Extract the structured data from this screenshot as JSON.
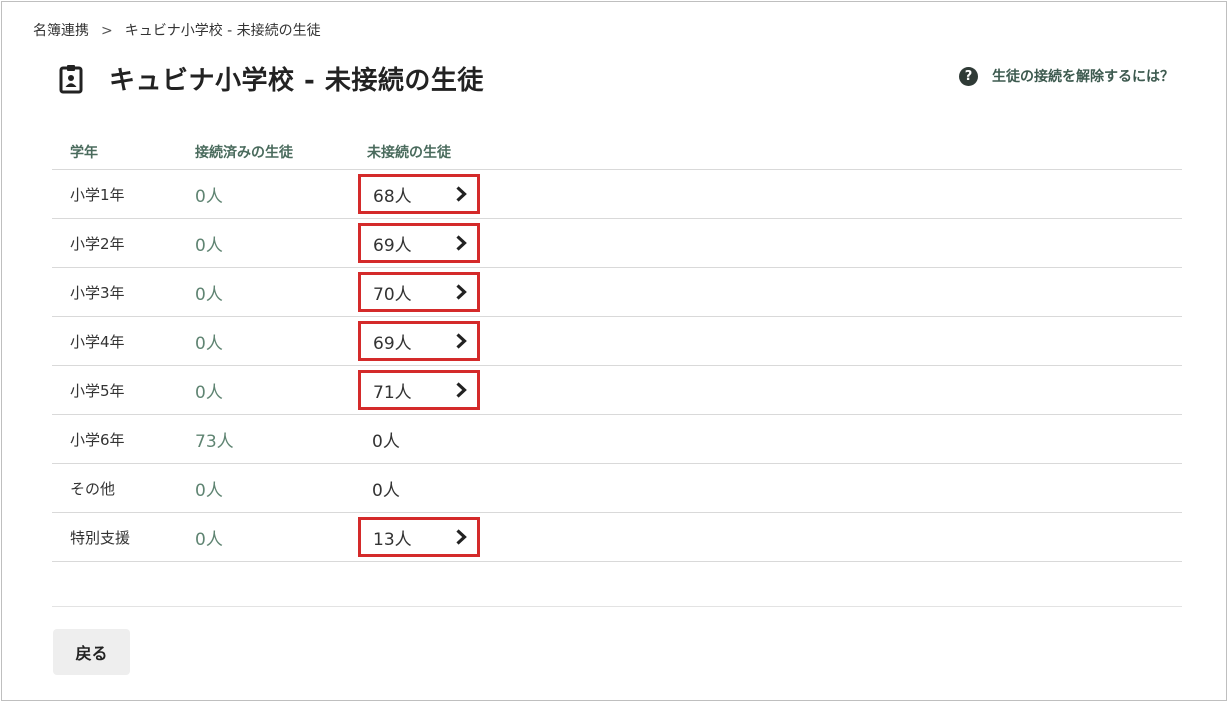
{
  "breadcrumb": {
    "root": "名簿連携",
    "separator": ">",
    "current": "キュビナ小学校 - 未接続の生徒"
  },
  "header": {
    "title": "キュビナ小学校 - 未接続の生徒",
    "icon": "id-badge-icon"
  },
  "help": {
    "icon": "question-circle-icon",
    "label": "生徒の接続を解除するには？"
  },
  "table": {
    "columns": [
      "学年",
      "接続済みの生徒",
      "未接続の生徒"
    ],
    "rows": [
      {
        "grade": "小学1年",
        "connected": "0人",
        "unconnected": "68人",
        "link": true
      },
      {
        "grade": "小学2年",
        "connected": "0人",
        "unconnected": "69人",
        "link": true
      },
      {
        "grade": "小学3年",
        "connected": "0人",
        "unconnected": "70人",
        "link": true
      },
      {
        "grade": "小学4年",
        "connected": "0人",
        "unconnected": "69人",
        "link": true
      },
      {
        "grade": "小学5年",
        "connected": "0人",
        "unconnected": "71人",
        "link": true
      },
      {
        "grade": "小学6年",
        "connected": "73人",
        "unconnected": "0人",
        "link": false
      },
      {
        "grade": "その他",
        "connected": "0人",
        "unconnected": "0人",
        "link": false
      },
      {
        "grade": "特別支援",
        "connected": "0人",
        "unconnected": "13人",
        "link": true
      }
    ]
  },
  "footer": {
    "back_label": "戻る"
  },
  "colors": {
    "highlight": "#d42a2a",
    "header_text": "#4a6b5d",
    "connected_text": "#5f8472"
  }
}
